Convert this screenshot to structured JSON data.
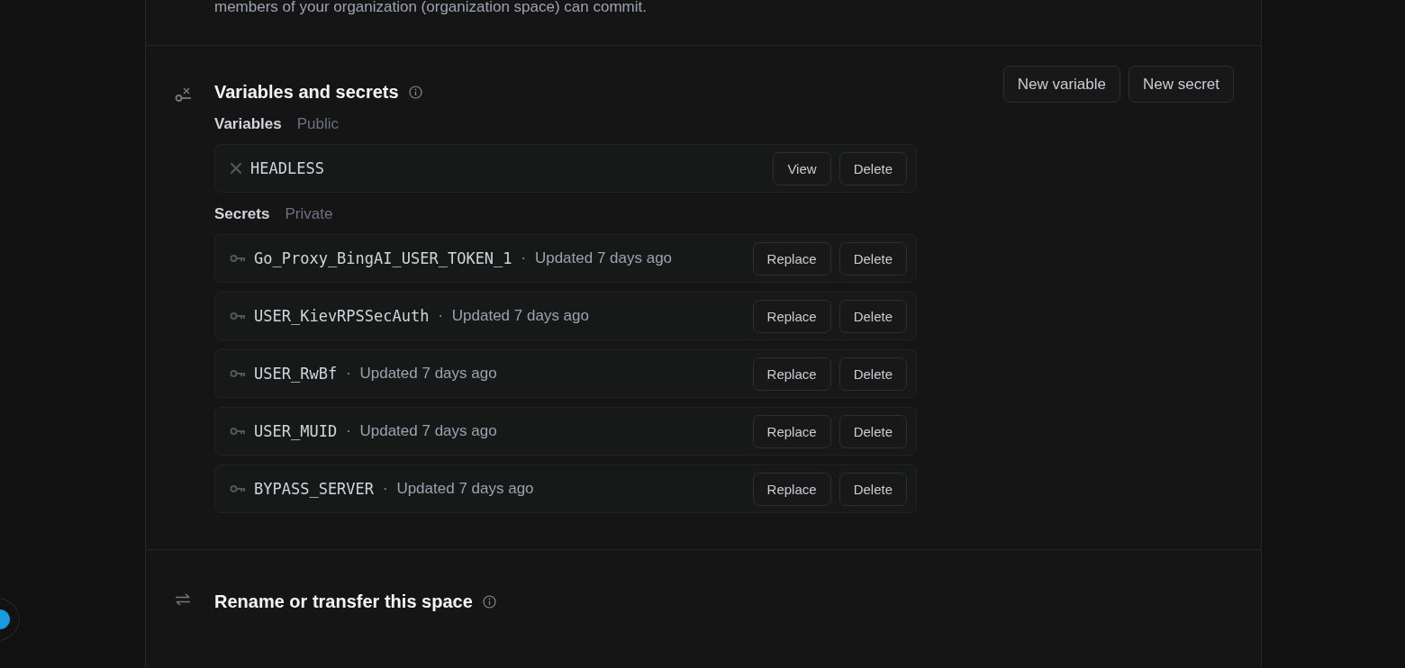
{
  "top_note": "members of your organization (organization space) can commit.",
  "variables_section": {
    "title": "Variables and secrets",
    "buttons": [
      "New variable",
      "New secret"
    ],
    "variables": {
      "heading": "Variables",
      "visibility": "Public",
      "items": [
        {
          "name": "HEADLESS",
          "actions": [
            "View",
            "Delete"
          ]
        }
      ]
    },
    "secrets": {
      "heading": "Secrets",
      "visibility": "Private",
      "items": [
        {
          "name": "Go_Proxy_BingAI_USER_TOKEN_1",
          "separator": "·",
          "updated": "Updated 7 days ago",
          "actions": [
            "Replace",
            "Delete"
          ]
        },
        {
          "name": "USER_KievRPSSecAuth",
          "separator": "·",
          "updated": "Updated 7 days ago",
          "actions": [
            "Replace",
            "Delete"
          ]
        },
        {
          "name": "USER_RwBf",
          "separator": "·",
          "updated": "Updated 7 days ago",
          "actions": [
            "Replace",
            "Delete"
          ]
        },
        {
          "name": "USER_MUID",
          "separator": "·",
          "updated": "Updated 7 days ago",
          "actions": [
            "Replace",
            "Delete"
          ]
        },
        {
          "name": "BYPASS_SERVER",
          "separator": "·",
          "updated": "Updated 7 days ago",
          "actions": [
            "Replace",
            "Delete"
          ]
        }
      ]
    }
  },
  "rename_section": {
    "title": "Rename or transfer this space"
  }
}
